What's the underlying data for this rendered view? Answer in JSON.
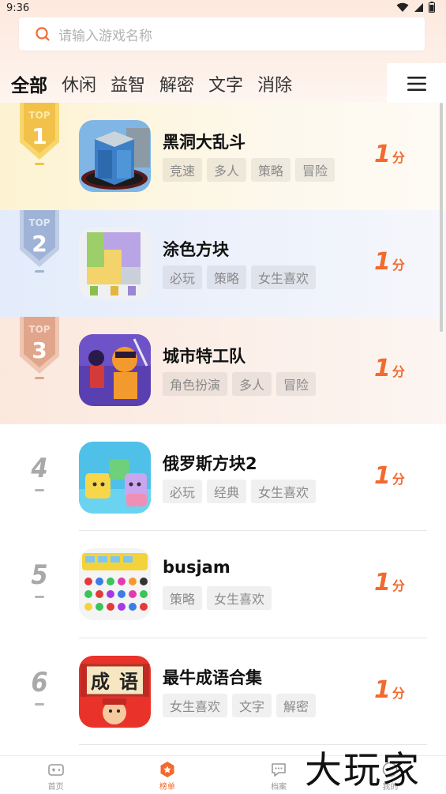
{
  "status_bar": {
    "time": "9:36"
  },
  "search": {
    "placeholder": "请输入游戏名称"
  },
  "tabs": [
    {
      "label": "全部",
      "active": true
    },
    {
      "label": "休闲"
    },
    {
      "label": "益智"
    },
    {
      "label": "解密"
    },
    {
      "label": "文字"
    },
    {
      "label": "消除"
    }
  ],
  "menu_icon": "hamburger-menu-icon",
  "games": [
    {
      "rank": "1",
      "badge_text": "TOP",
      "title": "黑洞大乱斗",
      "tags": [
        "竞速",
        "多人",
        "策略",
        "冒险"
      ],
      "score": "1",
      "score_unit": "分"
    },
    {
      "rank": "2",
      "badge_text": "TOP",
      "title": "涂色方块",
      "tags": [
        "必玩",
        "策略",
        "女生喜欢"
      ],
      "score": "1",
      "score_unit": "分"
    },
    {
      "rank": "3",
      "badge_text": "TOP",
      "title": "城市特工队",
      "tags": [
        "角色扮演",
        "多人",
        "冒险"
      ],
      "score": "1",
      "score_unit": "分"
    },
    {
      "rank": "4",
      "title": "俄罗斯方块2",
      "tags": [
        "必玩",
        "经典",
        "女生喜欢"
      ],
      "score": "1",
      "score_unit": "分"
    },
    {
      "rank": "5",
      "title": "busjam",
      "tags": [
        "策略",
        "女生喜欢"
      ],
      "score": "1",
      "score_unit": "分"
    },
    {
      "rank": "6",
      "title": "最牛成语合集",
      "tags": [
        "女生喜欢",
        "文字",
        "解密"
      ],
      "score": "1",
      "score_unit": "分",
      "icon_text": [
        "成",
        "语"
      ]
    }
  ],
  "bottom_nav": [
    {
      "label": "首页",
      "icon": "gamepad-icon"
    },
    {
      "label": "榜单",
      "icon": "ranking-icon",
      "active": true
    },
    {
      "label": "档案",
      "icon": "archive-icon"
    },
    {
      "label": "我的",
      "icon": "profile-icon"
    }
  ],
  "watermark": "大玩家",
  "colors": {
    "accent": "#f26a2e",
    "gold": "#f3c84d",
    "silver": "#9fb3d6",
    "bronze": "#e0a58a"
  }
}
